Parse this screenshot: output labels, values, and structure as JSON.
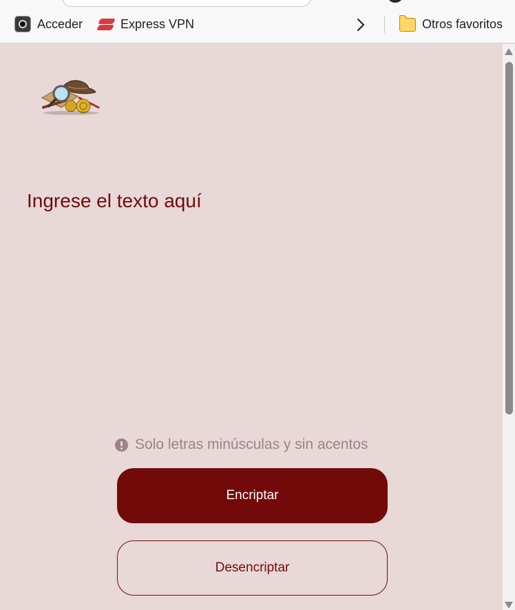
{
  "bookmarks_bar": {
    "items": [
      {
        "label": "Acceder",
        "icon": "acceder-app-icon"
      },
      {
        "label": "Express VPN",
        "icon": "expressvpn-logo-icon"
      }
    ],
    "more_icon": "chevron-right-icon",
    "folder": {
      "label": "Otros favoritos",
      "icon": "folder-icon"
    }
  },
  "page": {
    "logo_icon": "detective-magnifier-logo",
    "input": {
      "placeholder": "Ingrese el texto aquí",
      "value": ""
    },
    "hint": {
      "icon": "exclamation-circle-icon",
      "text": "Solo letras minúsculas y sin acentos"
    },
    "buttons": {
      "encrypt_label": "Encriptar",
      "decrypt_label": "Desencriptar"
    }
  },
  "colors": {
    "page_background": "#e8d8d8",
    "accent": "#720a0a",
    "hint_text": "#9d8287",
    "button_text_light": "#ffffff"
  }
}
